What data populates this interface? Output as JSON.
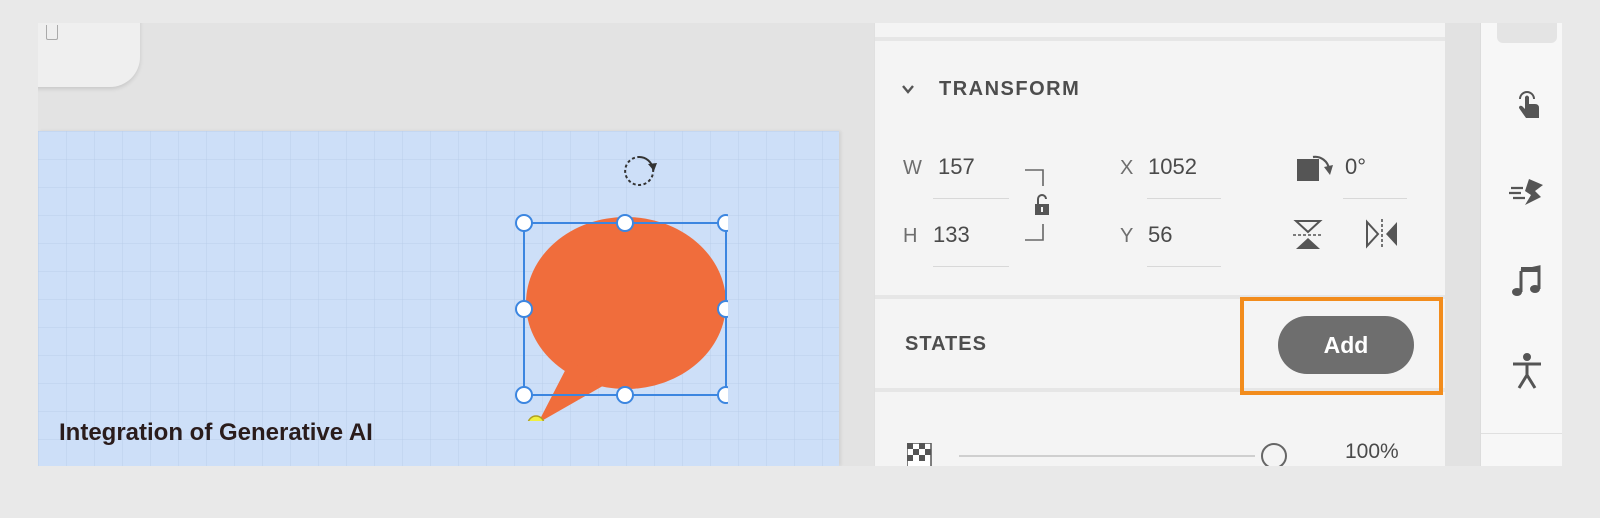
{
  "artboard": {
    "title": "Integration of Generative AI"
  },
  "selection": {
    "shape": "speech-bubble",
    "fill_color": "#f06d3c",
    "handle_color": "#3c86e0",
    "tail_handle_color": "#f0f040"
  },
  "transform": {
    "title": "TRANSFORM",
    "w_label": "W",
    "w_value": "157",
    "h_label": "H",
    "h_value": "133",
    "x_label": "X",
    "x_value": "1052",
    "y_label": "Y",
    "y_value": "56",
    "rotation_value": "0°"
  },
  "states": {
    "label": "STATES",
    "add_label": "Add",
    "highlight_color": "#f28c1c"
  },
  "appearance": {
    "opacity_value": "100%"
  },
  "rail": {
    "icons": [
      "tap-gesture-icon",
      "auto-animate-icon",
      "music-note-icon",
      "accessibility-icon"
    ]
  }
}
